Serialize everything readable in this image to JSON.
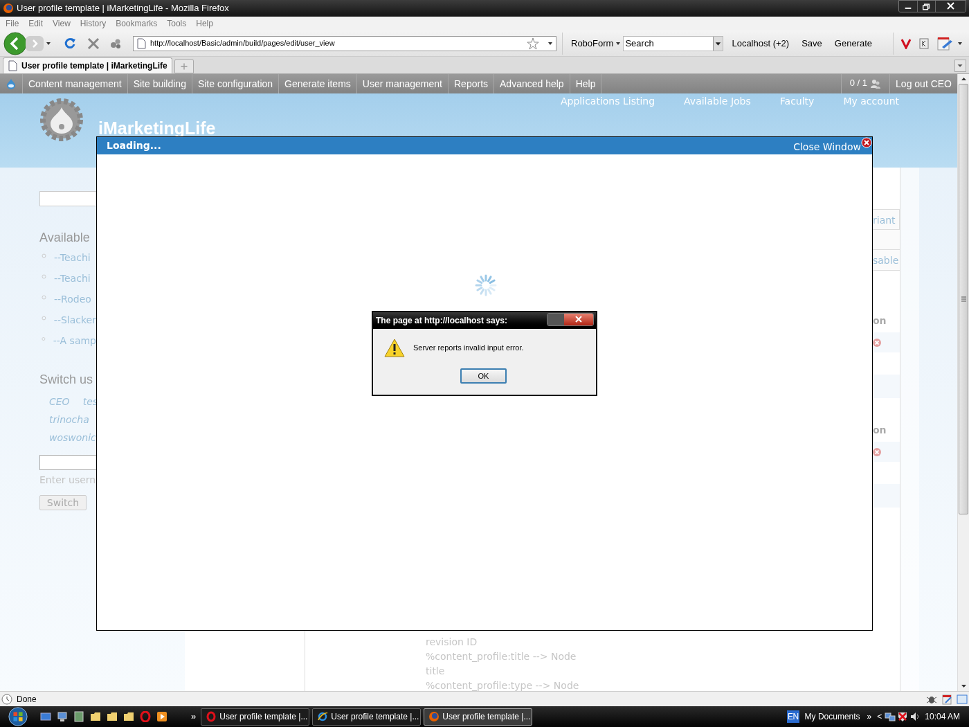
{
  "window": {
    "title": "User profile template | iMarketingLife - Mozilla Firefox"
  },
  "menu_bar": [
    "File",
    "Edit",
    "View",
    "History",
    "Bookmarks",
    "Tools",
    "Help"
  ],
  "toolbar": {
    "url": "http://localhost/Basic/admin/build/pages/edit/user_view",
    "roboform": "RoboForm",
    "search": {
      "value": "Search"
    },
    "buttons": [
      "Localhost (+2)",
      "Save",
      "Generate"
    ]
  },
  "tabs": [
    {
      "label": "User profile template | iMarketingLife",
      "selected": true
    }
  ],
  "admin_menu": {
    "items": [
      "Content management",
      "Site building",
      "Site configuration",
      "Generate items",
      "User management",
      "Reports",
      "Advanced help",
      "Help"
    ],
    "counter": "0 / 1",
    "logout": "Log out CEO"
  },
  "site": {
    "name": "iMarketingLife",
    "links": [
      "Applications Listing",
      "Available Jobs",
      "Faculty",
      "My account"
    ]
  },
  "sidebar": {
    "available_heading": "Available",
    "available_items": [
      "--Teachi",
      "--Teachi",
      "--Rodeo",
      "--Slacker",
      "--A samp"
    ],
    "switch_heading": "Switch us",
    "user_rows": [
      [
        "CEO",
        "tes"
      ],
      [
        "trinocha"
      ],
      [
        "woswonic"
      ]
    ],
    "username_hint": "Enter usern",
    "switch_button": "Switch"
  },
  "right_column": {
    "tabs": [
      "riant",
      "sable"
    ],
    "headings": [
      "on",
      "on"
    ]
  },
  "content_lines": [
    "revision ID",
    "%content_profile:title --> Node",
    "title",
    "%content_profile:type --> Node"
  ],
  "modal": {
    "title": "Loading...",
    "close": "Close Window"
  },
  "alert": {
    "title": "The page at http://localhost says:",
    "message": "Server reports invalid input error.",
    "button": "OK"
  },
  "status_bar": {
    "text": "Done"
  },
  "taskbar": {
    "more": "»",
    "tasks": [
      {
        "label": "User profile template |...",
        "selected": false
      },
      {
        "label": "User profile template |...",
        "selected": false
      },
      {
        "label": "User profile template |...",
        "selected": true
      }
    ],
    "language": "EN",
    "tray_label": "My Documents",
    "tray_more": "»",
    "tray_back": "<",
    "clock": "10:04 AM"
  }
}
